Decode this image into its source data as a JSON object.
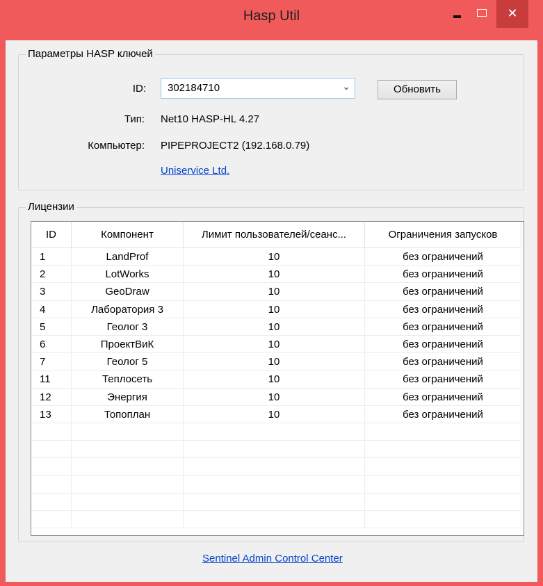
{
  "window": {
    "title": "Hasp Util"
  },
  "colors": {
    "titlebar": "#f05a5a",
    "link": "#0645cc"
  },
  "keys_group": {
    "label": "Параметры HASP ключей",
    "id_label": "ID:",
    "id_value": "302184710",
    "refresh_label": "Обновить",
    "type_label": "Тип:",
    "type_value": "Net10 HASP-HL 4.27",
    "computer_label": "Компьютер:",
    "computer_value": "PIPEPROJECT2 (192.168.0.79)",
    "vendor_link": "Uniservice Ltd."
  },
  "licenses_group": {
    "label": "Лицензии",
    "columns": [
      "ID",
      "Компонент",
      "Лимит пользователей/сеанс...",
      "Ограничения запусков"
    ],
    "rows": [
      {
        "id": "1",
        "component": "LandProf",
        "limit": "10",
        "restriction": "без ограничений"
      },
      {
        "id": "2",
        "component": "LotWorks",
        "limit": "10",
        "restriction": "без ограничений"
      },
      {
        "id": "3",
        "component": "GeoDraw",
        "limit": "10",
        "restriction": "без ограничений"
      },
      {
        "id": "4",
        "component": "Лаборатория 3",
        "limit": "10",
        "restriction": "без ограничений"
      },
      {
        "id": "5",
        "component": "Геолог 3",
        "limit": "10",
        "restriction": "без ограничений"
      },
      {
        "id": "6",
        "component": "ПроектВиК",
        "limit": "10",
        "restriction": "без ограничений"
      },
      {
        "id": "7",
        "component": "Геолог 5",
        "limit": "10",
        "restriction": "без ограничений"
      },
      {
        "id": "11",
        "component": "Теплосеть",
        "limit": "10",
        "restriction": "без ограничений"
      },
      {
        "id": "12",
        "component": "Энергия",
        "limit": "10",
        "restriction": "без ограничений"
      },
      {
        "id": "13",
        "component": "Топоплан",
        "limit": "10",
        "restriction": "без ограничений"
      }
    ]
  },
  "footer": {
    "link": "Sentinel Admin Control Center"
  }
}
